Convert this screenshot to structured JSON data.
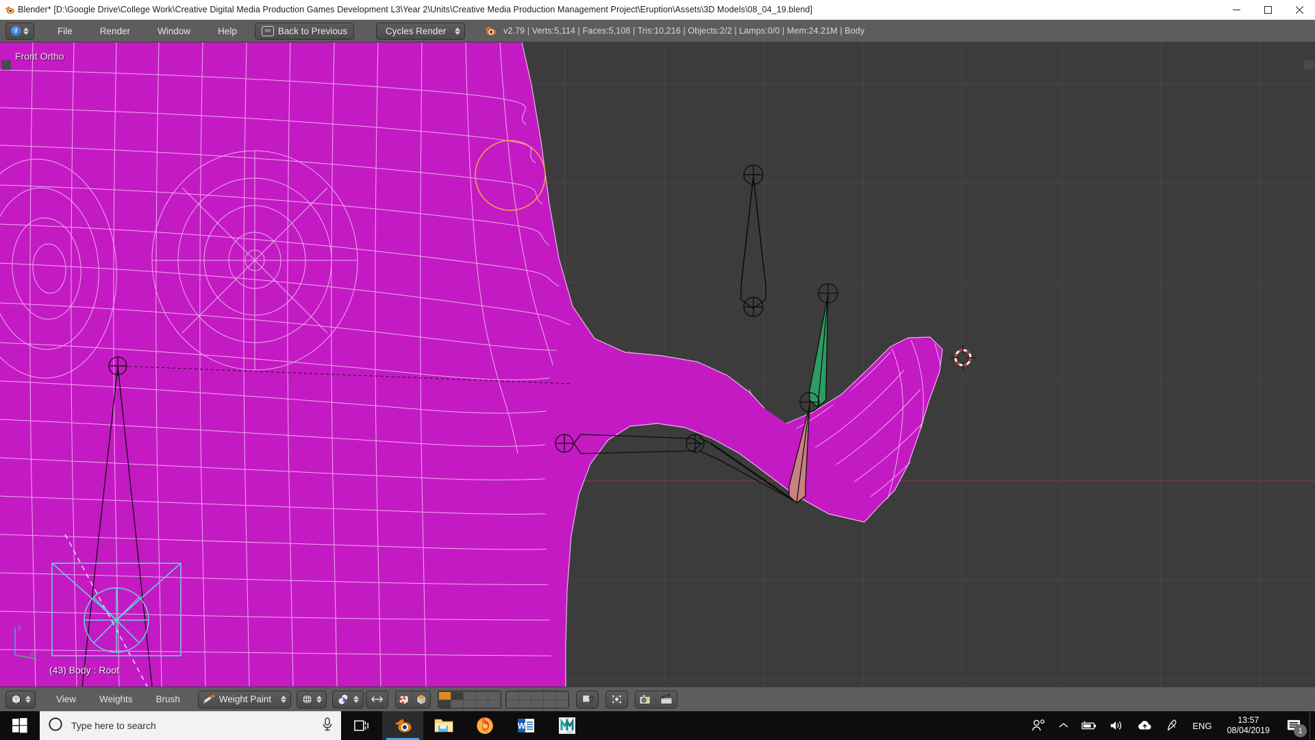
{
  "window": {
    "title": "Blender* [D:\\Google Drive\\College Work\\Creative Digital Media Production Games Development L3\\Year 2\\Units\\Creative Media Production Management Project\\Eruption\\Assets\\3D Models\\08_04_19.blend]",
    "app_icon": "blender-icon",
    "minimize_label": "Minimize",
    "maximize_label": "Restore",
    "close_label": "Close"
  },
  "topbar": {
    "editor_type_icon": "info-editor-icon",
    "menus": [
      "File",
      "Render",
      "Window",
      "Help"
    ],
    "back_to_previous": "Back to Previous",
    "back_icon": "back-arrow-icon",
    "render_engine": "Cycles Render",
    "blender_logo": "blender-logo-icon",
    "stats": "v2.79 | Verts:5,114 | Faces:5,108 | Tris:10,216 | Objects:2/2 | Lamps:0/0 | Mem:24.21M | Body",
    "stats_parts": {
      "version": "v2.79",
      "verts": "Verts:5,114",
      "faces": "Faces:5,108",
      "tris": "Tris:10,216",
      "objects": "Objects:2/2",
      "lamps": "Lamps:0/0",
      "mem": "Mem:24.21M",
      "active_object": "Body"
    }
  },
  "viewport": {
    "view_label": "Front Ortho",
    "bone_label": "(43) Body : Root",
    "background_color": "#3c3c3c",
    "mesh_color": "#c41ac4",
    "wire_color": "#ffc7ff",
    "bone_selected_color": "#2c9c63",
    "bone_active_color": "#c98080",
    "brush_circle_color": "#f0a050",
    "cursor_name": "3d-cursor",
    "axis_gizmo": {
      "z": "z",
      "y": "y"
    }
  },
  "bottombar": {
    "mode_icon": "object-mode-icon",
    "menus": [
      "View",
      "Weights",
      "Brush"
    ],
    "mode_label": "Weight Paint",
    "mode_icon_name": "weight-paint-icon",
    "pivot_icon": "pivot-median-icon",
    "snap_icon": "snap-magnet-icon",
    "proportional_icon": "proportional-edit-icon",
    "shading_icons": [
      "textured-shading-icon",
      "solid-shading-icon"
    ],
    "layer_grid_label": "scene-layers",
    "lock_icon": "lock-object-modes-icon",
    "manipulator_icon": "transform-manipulator-icon",
    "render_icon": "render-image-icon",
    "animation_icon": "render-animation-icon"
  },
  "taskbar": {
    "start_icon": "windows-start-icon",
    "search_placeholder": "Type here to search",
    "cortana_icon": "cortana-circle-icon",
    "mic_icon": "microphone-icon",
    "taskview_icon": "task-view-icon",
    "apps": [
      {
        "name": "blender-taskbar-icon",
        "label": "Blender",
        "active": true
      },
      {
        "name": "file-explorer-taskbar-icon",
        "label": "File Explorer",
        "active": false
      },
      {
        "name": "firefox-taskbar-icon",
        "label": "Firefox",
        "active": false
      },
      {
        "name": "word-taskbar-icon",
        "label": "Microsoft Word",
        "active": false
      },
      {
        "name": "mudbox-taskbar-icon",
        "label": "Mudbox",
        "active": false
      }
    ],
    "tray": [
      {
        "name": "people-icon",
        "label": "People"
      },
      {
        "name": "show-hidden-icons-chevron",
        "label": "Show hidden icons"
      },
      {
        "name": "battery-icon",
        "label": "Battery"
      },
      {
        "name": "volume-icon",
        "label": "Volume"
      },
      {
        "name": "onedrive-icon",
        "label": "OneDrive"
      },
      {
        "name": "pen-icon",
        "label": "Windows Ink"
      }
    ],
    "language": "ENG",
    "time": "13:57",
    "date": "08/04/2019",
    "notification_icon": "action-center-icon",
    "notification_count": "1"
  }
}
